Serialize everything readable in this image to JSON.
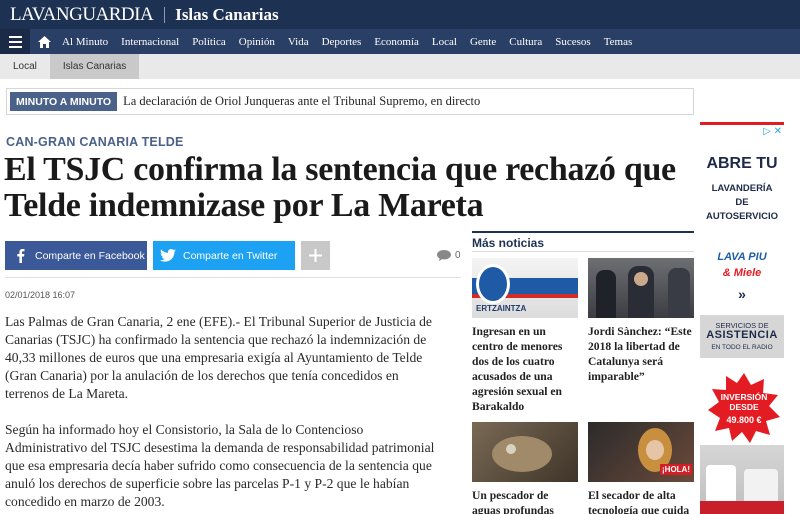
{
  "header": {
    "brand": "LAVANGUARDIA",
    "section": "Islas Canarias"
  },
  "nav": {
    "menu_icon": "hamburger-menu-icon",
    "home_icon": "home-icon",
    "items": [
      "Al Minuto",
      "Internacional",
      "Política",
      "Opinión",
      "Vida",
      "Deportes",
      "Economía",
      "Local",
      "Gente",
      "Cultura",
      "Sucesos",
      "Temas"
    ]
  },
  "breadcrumb": {
    "items": [
      "Local",
      "Islas Canarias"
    ]
  },
  "ticker": {
    "label": "MINUTO A MINUTO",
    "text": "La declaración de Oriol Junqueras ante el Tribunal Supremo, en directo"
  },
  "article": {
    "kicker": "CAN-GRAN CANARIA TELDE",
    "headline": "El TSJC confirma la sentencia que rechazó que Telde indemnizase por La Mareta",
    "share_facebook": "Comparte en Facebook",
    "share_twitter": "Comparte en Twitter",
    "comment_count": "0",
    "date": "02/01/2018 16:07",
    "paragraphs": [
      "Las Palmas de Gran Canaria, 2 ene (EFE).- El Tribunal Superior de Justicia de Canarias (TSJC) ha confirmado la sentencia que rechazó la indemnización de 40,33 millones de euros que una empresaria exigía al Ayuntamiento de Telde (Gran Canaria) por la anulación de los derechos que tenía concedidos en terrenos de La Mareta.",
      "Según ha informado hoy el Consistorio, la Sala de lo Contencioso Administrativo del TSJC desestima la demanda de responsabilidad patrimonial que esa empresaria decía haber sufrido como consecuencia de la sentencia que anuló los derechos de superficie sobre las parcelas P-1 y P-2 que le habían concedido en marzo de 2003."
    ]
  },
  "more_news": {
    "title": "Más noticias",
    "items": [
      {
        "headline": "Ingresan en un centro de menores dos de los cuatro acusados de una agresión sexual en Barakaldo",
        "thumb_text": "ERTZAINTZA"
      },
      {
        "headline": "Jordi Sànchez: “Este 2018 la libertad de Catalunya será imparable”",
        "thumb_text": ""
      },
      {
        "headline": "Un pescador de aguas profundas",
        "thumb_text": ""
      },
      {
        "headline": "El secador de alta tecnología que cuida",
        "thumb_text": "¡HOLA!"
      }
    ]
  },
  "ad": {
    "close_label": "▷ ✕",
    "line1": "ABRE TU",
    "line2": [
      "LAVANDERÍA",
      "DE",
      "AUTOSERVICIO"
    ],
    "logo1": "LAVA PIU",
    "logo2": "& Miele",
    "chevron": "»",
    "box": [
      "SERVICIOS DE",
      "ASISTENCIA",
      "EN TODO EL RADIO"
    ],
    "burst": [
      "INVERSIÓN",
      "DESDE"
    ],
    "amount": "49.800 €"
  },
  "colors": {
    "header_bg": "#1d3152",
    "nav_bg": "#2a3f66",
    "accent": "#4a6189",
    "facebook": "#3b5998",
    "twitter": "#1da1f2",
    "ad_red": "#e31c23"
  }
}
